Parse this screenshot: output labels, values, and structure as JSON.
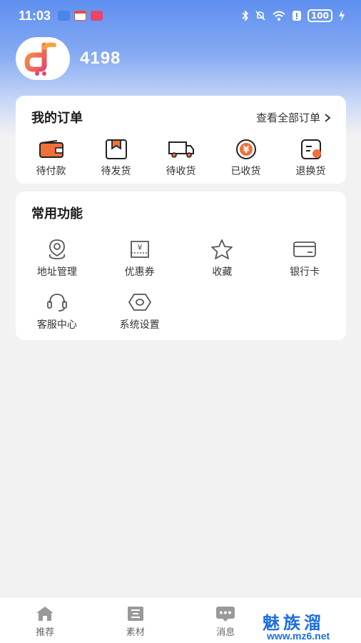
{
  "status_bar": {
    "time": "11:03",
    "battery": "100"
  },
  "profile": {
    "username": "4198"
  },
  "orders": {
    "title": "我的订单",
    "view_all": "查看全部订单",
    "items": [
      {
        "label": "待付款",
        "icon": "wallet-icon"
      },
      {
        "label": "待发货",
        "icon": "package-icon"
      },
      {
        "label": "待收货",
        "icon": "truck-icon"
      },
      {
        "label": "已收货",
        "icon": "yen-coin-icon"
      },
      {
        "label": "退换货",
        "icon": "return-icon"
      }
    ]
  },
  "functions": {
    "title": "常用功能",
    "items": [
      {
        "label": "地址管理",
        "icon": "location-icon"
      },
      {
        "label": "优惠券",
        "icon": "coupon-icon"
      },
      {
        "label": "收藏",
        "icon": "star-icon"
      },
      {
        "label": "银行卡",
        "icon": "bank-card-icon"
      },
      {
        "label": "客服中心",
        "icon": "headset-icon"
      },
      {
        "label": "系统设置",
        "icon": "settings-icon"
      }
    ]
  },
  "tabbar": {
    "items": [
      {
        "label": "推荐",
        "icon": "home-icon"
      },
      {
        "label": "素材",
        "icon": "document-icon"
      },
      {
        "label": "消息",
        "icon": "message-icon"
      }
    ]
  },
  "watermark": {
    "text": "魅族溜",
    "url": "www.mz6.net"
  },
  "colors": {
    "accent": "#f0703a",
    "header_blue": "#5e8ff0",
    "watermark_blue": "#1d6fe0"
  }
}
